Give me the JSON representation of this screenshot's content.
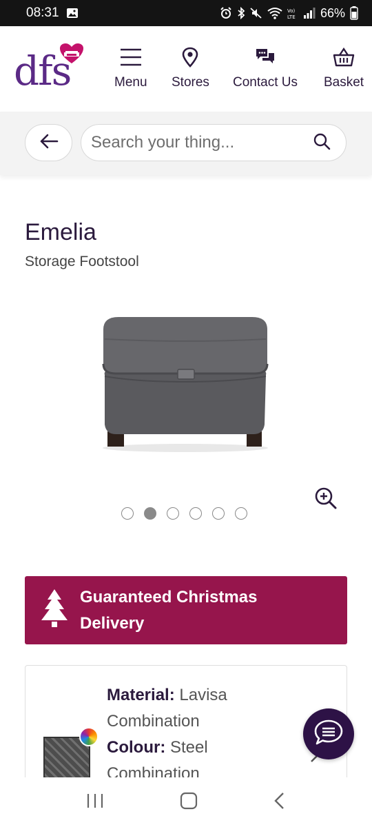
{
  "status_bar": {
    "time": "08:31",
    "battery": "66%"
  },
  "header": {
    "logo_text": "dfs",
    "nav": [
      {
        "label": "Menu",
        "icon": "hamburger-icon"
      },
      {
        "label": "Stores",
        "icon": "location-pin-icon"
      },
      {
        "label": "Contact Us",
        "icon": "chat-bubbles-icon"
      },
      {
        "label": "Basket",
        "icon": "basket-icon"
      }
    ]
  },
  "search": {
    "placeholder": "Search your thing..."
  },
  "product": {
    "name": "Emelia",
    "type": "Storage Footstool",
    "carousel": {
      "total": 6,
      "active_index": 1
    }
  },
  "banner": {
    "text": "Guaranteed Christmas Delivery"
  },
  "option": {
    "material_label": "Material:",
    "material_value": "Lavisa Combination",
    "colour_label": "Colour:",
    "colour_value": "Steel Combination"
  },
  "colors": {
    "brand_purple": "#5b2a86",
    "banner_magenta": "#96154c",
    "chat_purple": "#2d1246"
  }
}
